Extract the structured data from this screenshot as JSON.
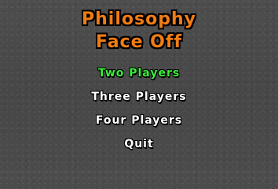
{
  "title": {
    "line1": "Philosophy",
    "line2": "Face Off"
  },
  "menu": {
    "items": [
      {
        "label": "Two Players",
        "selected": true
      },
      {
        "label": "Three Players",
        "selected": false
      },
      {
        "label": "Four Players",
        "selected": false
      },
      {
        "label": "Quit",
        "selected": false
      }
    ]
  },
  "colors": {
    "background": "#4a4a4a",
    "title": "#f07c14",
    "menu_default": "#ffffff",
    "menu_selected": "#39ef3a"
  }
}
